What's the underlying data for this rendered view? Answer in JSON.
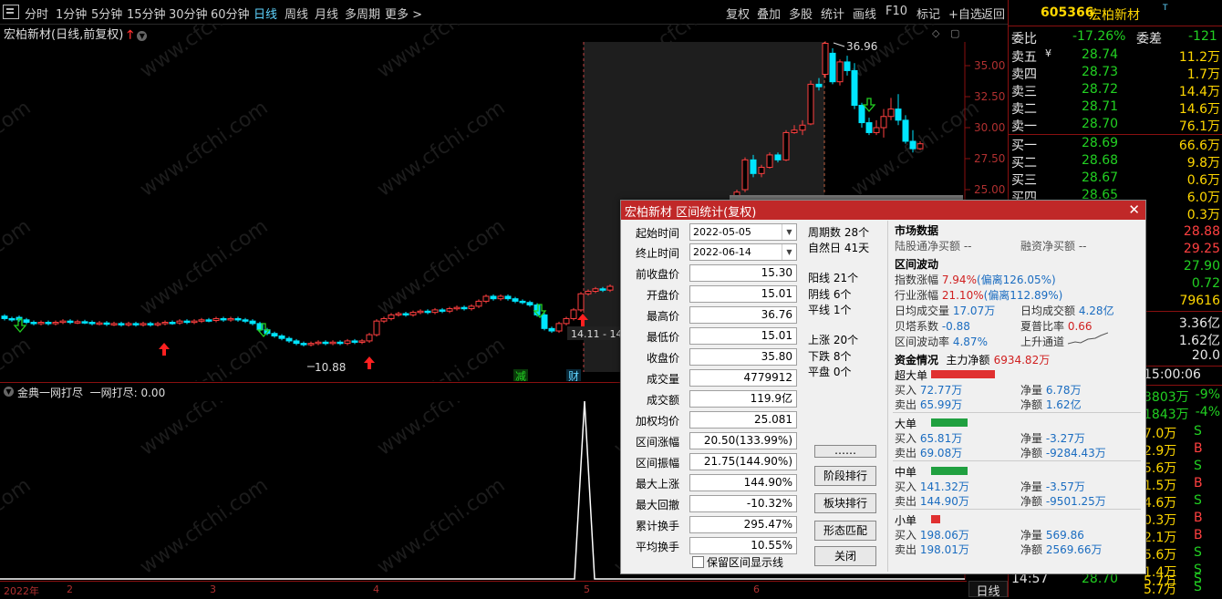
{
  "toolbar": {
    "periods": [
      "分时",
      "1分钟",
      "5分钟",
      "15分钟",
      "30分钟",
      "60分钟",
      "日线",
      "周线",
      "月线",
      "多周期",
      "更多 >"
    ],
    "active": "日线",
    "tools": [
      "复权",
      "叠加",
      "多股",
      "统计",
      "画线",
      "F10",
      "标记",
      "+自选",
      "返回"
    ]
  },
  "chart": {
    "title": "宏柏新材(日线,前复权)",
    "price_labels": [
      "35.00",
      "32.50",
      "30.00",
      "27.50",
      "25.00"
    ],
    "high_label": "36.96",
    "low_label": "10.88",
    "range_label": "14.11 - 14",
    "event_jian": "减",
    "event_cai": "财",
    "watermark": "www.cfchi.com"
  },
  "indicator": {
    "label": "金典一网打尽  一网打尽: 0.00"
  },
  "date_axis": [
    "2022年",
    "2",
    "3",
    "4",
    "5",
    "6"
  ],
  "period_label": "日线",
  "quote": {
    "code": "605366",
    "name": "宏柏新材",
    "ratio_label": "委比",
    "ratio_value": "-17.26%",
    "diff_label": "委差",
    "diff_value": "-121",
    "asks": [
      {
        "label": "卖五",
        "price": "28.74",
        "vol": "11.2万"
      },
      {
        "label": "卖四",
        "price": "28.73",
        "vol": "1.7万"
      },
      {
        "label": "卖三",
        "price": "28.72",
        "vol": "14.4万"
      },
      {
        "label": "卖二",
        "price": "28.71",
        "vol": "14.6万"
      },
      {
        "label": "卖一",
        "price": "28.70",
        "vol": "76.1万"
      }
    ],
    "bids": [
      {
        "label": "买一",
        "price": "28.69",
        "vol": "66.6万"
      },
      {
        "label": "买二",
        "price": "28.68",
        "vol": "9.8万"
      },
      {
        "label": "买三",
        "price": "28.67",
        "vol": "0.6万"
      },
      {
        "label": "买四",
        "price": "28.65",
        "vol": "6.0万"
      },
      {
        "label": "",
        "price": "",
        "vol": "0.3万"
      }
    ],
    "stats_right": [
      "28.88",
      "29.25",
      "27.90",
      "0.72",
      "79616"
    ],
    "vol_lines": [
      "3.36亿",
      "1.62亿",
      "20.0"
    ],
    "time": "15:00:06",
    "flows": [
      {
        "v": "3803万",
        "p": "-9%"
      },
      {
        "v": "1843万",
        "p": "-4%"
      }
    ],
    "ticks": [
      {
        "v": "7.0万",
        "s": "S"
      },
      {
        "v": "2.9万",
        "s": "B"
      },
      {
        "v": "5.6万",
        "s": "S"
      },
      {
        "v": "1.5万",
        "s": "B"
      },
      {
        "v": "4.6万",
        "s": "S"
      },
      {
        "v": "0.3万",
        "s": "B"
      },
      {
        "v": "2.1万",
        "s": "B"
      },
      {
        "v": "5.6万",
        "s": "S"
      },
      {
        "v": "1.4万",
        "s": "S"
      },
      {
        "v": "5.7万",
        "s": "S"
      }
    ],
    "last_tick": {
      "time": "14:57",
      "price": "28.70",
      "vol": "5.7万",
      "s": "S"
    }
  },
  "dialog": {
    "title": "宏柏新材 区间统计(复权)",
    "start_label": "起始时间",
    "start_value": "2022-05-05",
    "end_label": "终止时间",
    "end_value": "2022-06-14",
    "fields": [
      {
        "label": "前收盘价",
        "value": "15.30"
      },
      {
        "label": "开盘价",
        "value": "15.01"
      },
      {
        "label": "最高价",
        "value": "36.76"
      },
      {
        "label": "最低价",
        "value": "15.01"
      },
      {
        "label": "收盘价",
        "value": "35.80"
      },
      {
        "label": "成交量",
        "value": "4779912"
      },
      {
        "label": "成交额",
        "value": "119.9亿"
      },
      {
        "label": "加权均价",
        "value": "25.081"
      },
      {
        "label": "区间涨幅",
        "value": "20.50(133.99%)"
      },
      {
        "label": "区间振幅",
        "value": "21.75(144.90%)"
      },
      {
        "label": "最大上涨",
        "value": "144.90%"
      },
      {
        "label": "最大回撤",
        "value": "-10.32%"
      },
      {
        "label": "累计换手",
        "value": "295.47%"
      },
      {
        "label": "平均换手",
        "value": "10.55%"
      }
    ],
    "checkbox_label": "保留区间显示线",
    "mid": {
      "periods": "周期数 28个",
      "natural": "自然日 41天",
      "yang": "阳线 21个",
      "yin": "阴线 6个",
      "flat": "平线 1个",
      "up": "上涨 20个",
      "down": "下跌 8个",
      "even": "平盘 0个"
    },
    "buttons": [
      "……",
      "阶段排行",
      "板块排行",
      "形态匹配",
      "关闭"
    ],
    "market": {
      "head": "市场数据",
      "lgt": "陆股通净买额 --",
      "rz": "融资净买额 --"
    },
    "wave": {
      "head": "区间波动",
      "index_label": "指数涨幅",
      "index_value": "7.94%",
      "index_dev": "(偏离126.05%)",
      "ind_label": "行业涨幅",
      "ind_value": "21.10%",
      "ind_dev": "(偏离112.89%)",
      "avgvol_label": "日均成交量",
      "avgvol_value": "17.07万",
      "avgamt_label": "日均成交额",
      "avgamt_value": "4.28亿",
      "beta_label": "贝塔系数",
      "beta_value": "-0.88",
      "sharpe_label": "夏普比率",
      "sharpe_value": "0.66",
      "vola_label": "区间波动率",
      "vola_value": "4.87%",
      "trend_label": "上升通道"
    },
    "funds": {
      "head": "资金情况",
      "main_label": "主力净额",
      "main_value": "6934.82万",
      "groups": [
        {
          "name": "超大单",
          "bar": "#e03030",
          "barw": 70,
          "buy": "72.77万",
          "net": "6.78万",
          "sell": "65.99万",
          "netamt": "1.62亿"
        },
        {
          "name": "大单",
          "bar": "#20a040",
          "barw": 40,
          "buy": "65.81万",
          "net": "-3.27万",
          "sell": "69.08万",
          "netamt": "-9284.43万"
        },
        {
          "name": "中单",
          "bar": "#20a040",
          "barw": 40,
          "buy": "141.32万",
          "net": "-3.57万",
          "sell": "144.90万",
          "netamt": "-9501.25万"
        },
        {
          "name": "小单",
          "bar": "#e03030",
          "barw": 10,
          "buy": "198.06万",
          "net": "569.86",
          "sell": "198.01万",
          "netamt": "2569.66万"
        }
      ],
      "buy_label": "买入",
      "sell_label": "卖出",
      "net_label": "净量",
      "netamt_label": "净额"
    }
  }
}
